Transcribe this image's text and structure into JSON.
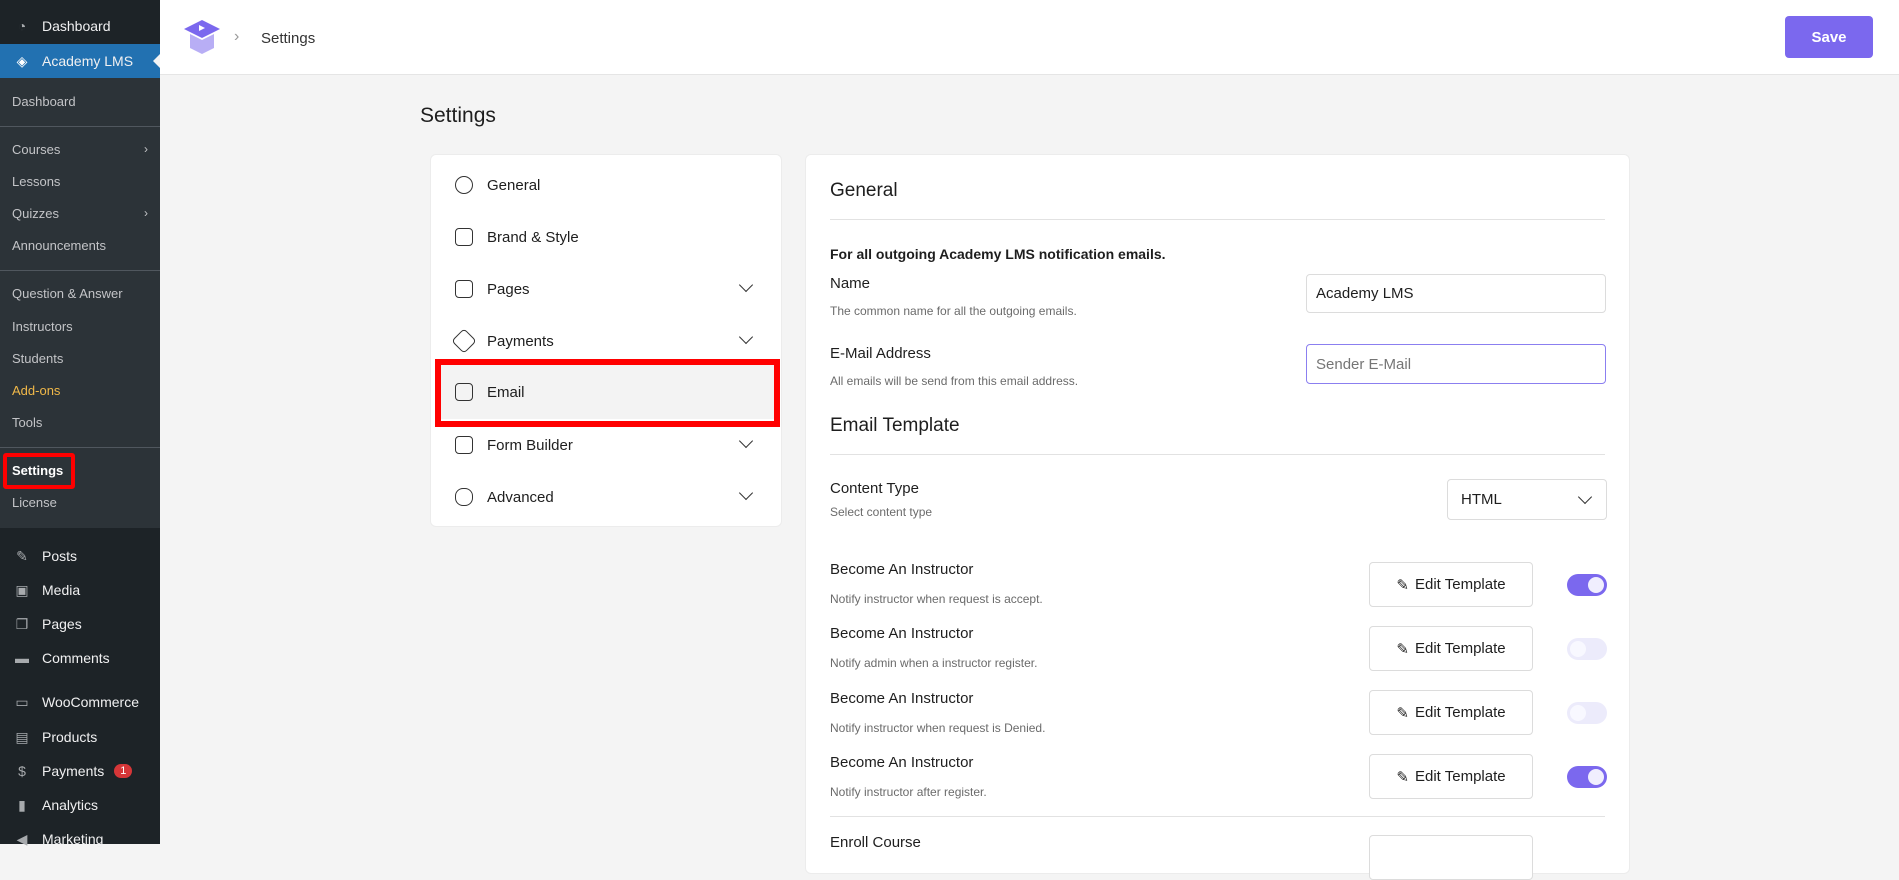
{
  "wp_menu": {
    "top": "Dashboard",
    "active": "Academy LMS",
    "submenu": [
      "Dashboard",
      "Courses",
      "Lessons",
      "Quizzes",
      "Announcements",
      "Question & Answer",
      "Instructors",
      "Students",
      "Add-ons",
      "Tools",
      "Settings",
      "License"
    ],
    "items": [
      "Posts",
      "Media",
      "Pages",
      "Comments",
      "WooCommerce",
      "Products",
      "Payments",
      "Analytics",
      "Marketing"
    ],
    "payments_badge": "1"
  },
  "header": {
    "breadcrumb": "Settings",
    "save_label": "Save"
  },
  "page_title": "Settings",
  "settings_menu": [
    "General",
    "Brand & Style",
    "Pages",
    "Payments",
    "Email",
    "Form Builder",
    "Advanced"
  ],
  "panel": {
    "section1": "General",
    "intro": "For all outgoing Academy LMS notification emails.",
    "name_label": "Name",
    "name_desc": "The common name for all the outgoing emails.",
    "name_value": "Academy LMS",
    "email_label": "E-Mail Address",
    "email_desc": "All emails will be send from this email address.",
    "email_placeholder": "Sender E-Mail",
    "section2": "Email Template",
    "content_type_label": "Content Type",
    "content_type_desc": "Select content type",
    "content_type_value": "HTML",
    "edit_label": "Edit Template",
    "templates": [
      {
        "title": "Become An Instructor",
        "desc": "Notify instructor when request is accept.",
        "enabled": true
      },
      {
        "title": "Become An Instructor",
        "desc": "Notify admin when a instructor register.",
        "enabled": false
      },
      {
        "title": "Become An Instructor",
        "desc": "Notify instructor when request is Denied.",
        "enabled": false
      },
      {
        "title": "Become An Instructor",
        "desc": "Notify instructor after register.",
        "enabled": true
      }
    ],
    "next_title": "Enroll Course"
  },
  "colors": {
    "accent": "#7b68ee",
    "wp_blue": "#2271b1",
    "highlight": "#ff0000"
  }
}
